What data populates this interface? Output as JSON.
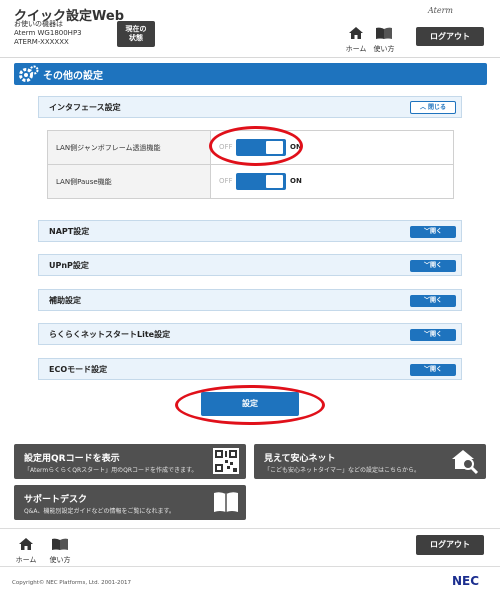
{
  "header": {
    "app_title": "クイック設定Web",
    "device_label": "お使いの機器は",
    "model": "Aterm WG1800HP3",
    "ssid": "ATERM-XXXXXX",
    "status_button": [
      "現在の",
      "状態"
    ],
    "brand": "Aterm",
    "nav_home": "ホーム",
    "nav_help": "使い方",
    "logout": "ログアウト"
  },
  "section": {
    "title": "その他の設定"
  },
  "interface_panel": {
    "title": "インタフェース設定",
    "close_label": "閉じる",
    "rows": [
      {
        "label": "LAN側ジャンボフレーム透過機能",
        "off": "OFF",
        "on": "ON",
        "state": "ON"
      },
      {
        "label": "LAN側Pause機能",
        "off": "OFF",
        "on": "ON",
        "state": "ON"
      }
    ]
  },
  "collapsed_panels": [
    {
      "title": "NAPT設定",
      "open_label": "開く"
    },
    {
      "title": "UPnP設定",
      "open_label": "開く"
    },
    {
      "title": "補助設定",
      "open_label": "開く"
    },
    {
      "title": "らくらくネットスタートLite設定",
      "open_label": "開く"
    },
    {
      "title": "ECOモード設定",
      "open_label": "開く"
    }
  ],
  "submit_label": "設定",
  "cards": {
    "qr": {
      "title": "設定用QRコードを表示",
      "desc": "「AtermらくらくQRスタート」用のQRコードを作成できます。"
    },
    "safety": {
      "title": "見えて安心ネット",
      "desc": "「こども安心ネットタイマー」などの設定はこちらから。"
    },
    "support": {
      "title": "サポートデスク",
      "desc": "Q&A、機能別設定ガイドなどの情報をご覧になれます。"
    }
  },
  "footer": {
    "nav_home": "ホーム",
    "nav_help": "使い方",
    "logout": "ログアウト",
    "copyright": "Copyright© NEC Platforms, Ltd. 2001-2017",
    "brand": "NEC"
  },
  "colors": {
    "accent": "#1e73be",
    "dark_button": "#3f3f3f",
    "annotation": "#e0101a"
  }
}
